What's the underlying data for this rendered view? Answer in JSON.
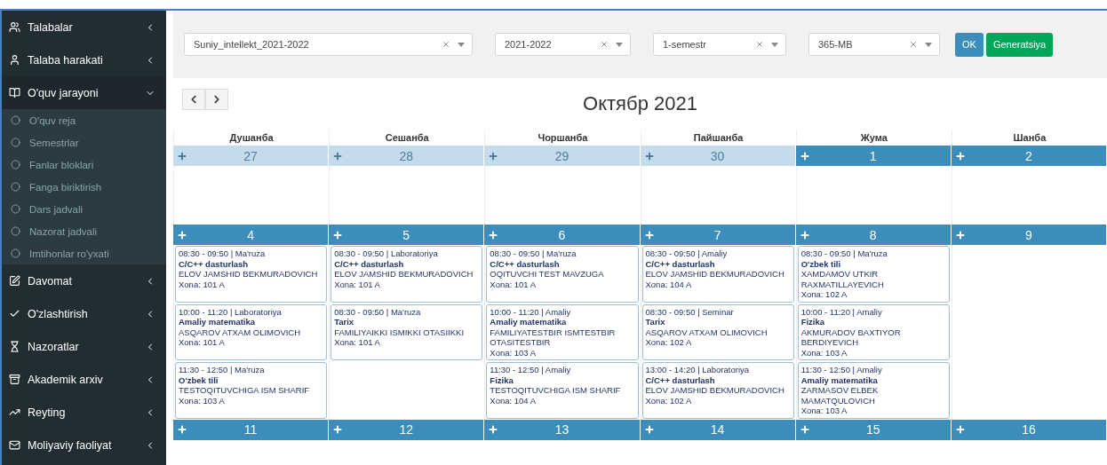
{
  "sidebar": {
    "items": [
      {
        "label": "Talabalar",
        "expanded": false
      },
      {
        "label": "Talaba harakati",
        "expanded": false
      },
      {
        "label": "O'quv jarayoni",
        "expanded": true,
        "children": [
          {
            "label": "O'quv reja"
          },
          {
            "label": "Semestrlar"
          },
          {
            "label": "Fanlar bloklari"
          },
          {
            "label": "Fanga biriktirish"
          },
          {
            "label": "Dars jadvali"
          },
          {
            "label": "Nazorat jadvali"
          },
          {
            "label": "Imtihonlar ro'yxati"
          }
        ]
      },
      {
        "label": "Davomat",
        "expanded": false
      },
      {
        "label": "O'zlashtirish",
        "expanded": false
      },
      {
        "label": "Nazoratlar",
        "expanded": false
      },
      {
        "label": "Akademik arxiv",
        "expanded": false
      },
      {
        "label": "Reyting",
        "expanded": false
      },
      {
        "label": "Moliyaviy faoliyat",
        "expanded": false
      }
    ]
  },
  "filters": [
    {
      "value": "Suniy_intellekt_2021-2022"
    },
    {
      "value": "2021-2022"
    },
    {
      "value": "1-semestr"
    },
    {
      "value": "365-MB"
    }
  ],
  "buttons": [
    {
      "label": "OK",
      "kind": "primary"
    },
    {
      "label": "Generatsiya",
      "kind": "success"
    }
  ],
  "calendar": {
    "title": "Октябр 2021",
    "weekdays": [
      "Душанба",
      "Сешанба",
      "Чоршанба",
      "Пайшанба",
      "Жума",
      "Шанба"
    ],
    "weeks": [
      {
        "days": [
          {
            "number": "27",
            "other_month": true
          },
          {
            "number": "28",
            "other_month": true
          },
          {
            "number": "29",
            "other_month": true
          },
          {
            "number": "30",
            "other_month": true
          },
          {
            "number": "1",
            "other_month": false
          },
          {
            "number": "2",
            "other_month": false
          }
        ]
      },
      {
        "days": [
          {
            "number": "4",
            "other_month": false,
            "events": [
              {
                "time": "08:30 - 09:50 | Ma'ruza",
                "subject": "C/C++ dasturlash",
                "teacher": "ELOV JAMSHID BEKMURADOVICH",
                "room": "Xona: 101 A"
              },
              {
                "time": "10:00 - 11:20 | Laboratoriya",
                "subject": "Amaliy matematika",
                "teacher": "ASQAROV ATXAM OLIMOVICH",
                "room": "Xona: 101 A"
              },
              {
                "time": "11:30 - 12:50 | Ma'ruza",
                "subject": "O'zbek tili",
                "teacher": "TESTOQITUVCHIGA ISM SHARIF",
                "room": "Xona: 103 A"
              }
            ]
          },
          {
            "number": "5",
            "other_month": false,
            "events": [
              {
                "time": "08:30 - 09:50 | Laboratoriya",
                "subject": "C/C++ dasturlash",
                "teacher": "ELOV JAMSHID BEKMURADOVICH",
                "room": "Xona: 101 A"
              },
              {
                "time": "08:30 - 09:50 | Ma'ruza",
                "subject": "Tarix",
                "teacher": "FAMILIYAIKKI ISMIKKI OTASIIKKI",
                "room": "Xona: 101 A"
              }
            ]
          },
          {
            "number": "6",
            "other_month": false,
            "events": [
              {
                "time": "08:30 - 09:50 | Ma'ruza",
                "subject": "C/C++ dasturlash",
                "teacher": "OQITUVCHI TEST MAVZUGA",
                "room": "Xona: 101 A"
              },
              {
                "time": "10:00 - 11:20 | Amaliy",
                "subject": "Amaliy matematika",
                "teacher": "FAMILIYATESTBIR ISMTESTBIR OTASITESTBIR",
                "room": "Xona: 103 A"
              },
              {
                "time": "11:30 - 12:50 | Amaliy",
                "subject": "Fizika",
                "teacher": "TESTOQITUVCHIGA ISM SHARIF",
                "room": "Xona: 104 A"
              }
            ]
          },
          {
            "number": "7",
            "other_month": false,
            "events": [
              {
                "time": "08:30 - 09:50 | Amaliy",
                "subject": "C/C++ dasturlash",
                "teacher": "ELOV JAMSHID BEKMURADOVICH",
                "room": "Xona: 104 A"
              },
              {
                "time": "08:30 - 09:50 | Seminar",
                "subject": "Tarix",
                "teacher": "ASQAROV ATXAM OLIMOVICH",
                "room": "Xona: 102 A"
              },
              {
                "time": "13:00 - 14:20 | Laboratoriya",
                "subject": "C/C++ dasturlash",
                "teacher": "ELOV JAMSHID BEKMURADOVICH",
                "room": "Xona: 102 A"
              }
            ]
          },
          {
            "number": "8",
            "other_month": false,
            "events": [
              {
                "time": "08:30 - 09:50 | Ma'ruza",
                "subject": "O'zbek tili",
                "teacher": "XAMDAMOV UTKIR RAXMATILLAYEVICH",
                "room": "Xona: 102 A"
              },
              {
                "time": "10:00 - 11:20 | Amaliy",
                "subject": "Fizika",
                "teacher": "AKMURADOV BAXTIYOR BERDIYEVICH",
                "room": "Xona: 103 A"
              },
              {
                "time": "11:30 - 12:50 | Amaliy",
                "subject": "Amaliy matematika",
                "teacher": "ZARMASOV ELBEK MAMATQULOVICH",
                "room": "Xona: 103 A"
              }
            ]
          },
          {
            "number": "9",
            "other_month": false
          }
        ]
      },
      {
        "days": [
          {
            "number": "11",
            "other_month": false
          },
          {
            "number": "12",
            "other_month": false
          },
          {
            "number": "13",
            "other_month": false
          },
          {
            "number": "14",
            "other_month": false
          },
          {
            "number": "15",
            "other_month": false
          },
          {
            "number": "16",
            "other_month": false
          }
        ]
      }
    ]
  }
}
